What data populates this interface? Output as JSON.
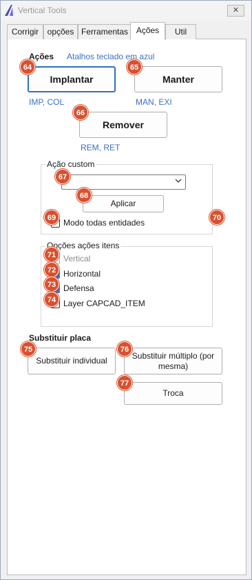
{
  "window": {
    "title": "Vertical Tools",
    "close_glyph": "✕"
  },
  "tabs": [
    {
      "label": "Corrigir"
    },
    {
      "label": "opções"
    },
    {
      "label": "Ferramentas"
    },
    {
      "label": "Ações",
      "active": true
    },
    {
      "label": "Util"
    }
  ],
  "acoes": {
    "heading": "Ações",
    "hint": "Atalhos teclado em azul",
    "implantar": "Implantar",
    "implantar_keys": "IMP, COL",
    "manter": "Manter",
    "manter_keys": "MAN, EXI",
    "remover": "Remover",
    "remover_keys": "REM, RET"
  },
  "acao_custom": {
    "title": "Ação custom",
    "combo_value": "",
    "apply": "Aplicar",
    "modo_todas": "Modo todas entidades",
    "modo_todas_checked": false
  },
  "opcoes_itens": {
    "title": "Opções ações itens",
    "vertical": "Vertical",
    "horizontal": "Horizontal",
    "defensa": "Defensa",
    "layer": "Layer CAPCAD_ITEM"
  },
  "substituir": {
    "heading": "Substituir placa",
    "individual": "Substituir individual",
    "multiplo": "Substituir múltiplo (por mesma)",
    "troca": "Troca"
  },
  "badges": [
    "64",
    "65",
    "66",
    "67",
    "68",
    "69",
    "70",
    "71",
    "72",
    "73",
    "74",
    "75",
    "76",
    "77"
  ],
  "colors": {
    "accent": "#3a6fc8",
    "badge": "#d9502e"
  }
}
